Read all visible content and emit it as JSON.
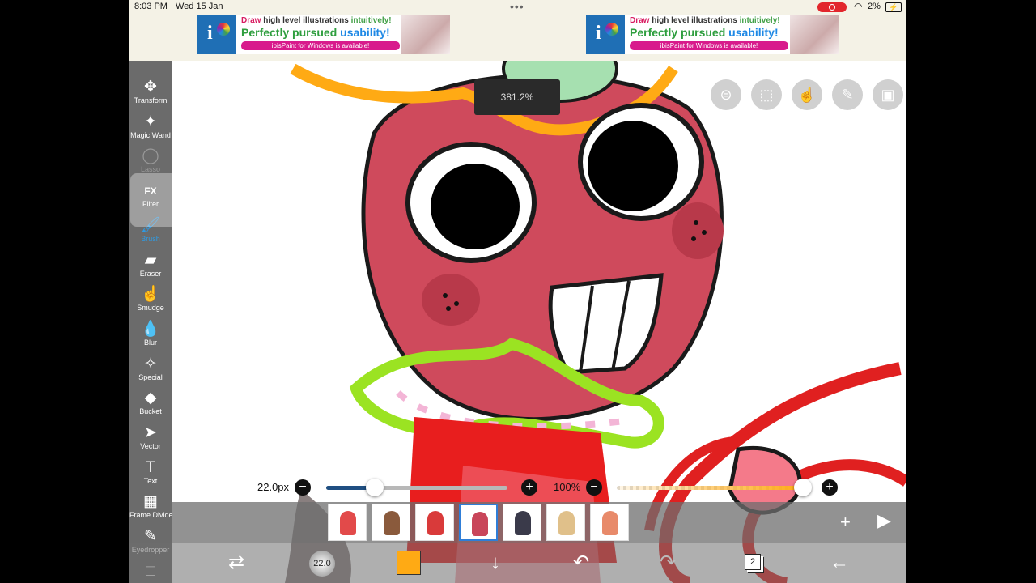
{
  "status": {
    "time": "8:03 PM",
    "date": "Wed 15 Jan",
    "dots": "•••",
    "battery_pct": "2%",
    "battery_glyph": "⚡"
  },
  "ad": {
    "draw": "Draw",
    "line1_rest_a": " high level illustrations ",
    "line1_green": "intuitively!",
    "line2_a": "Perfectly pursued ",
    "line2_b": "usability!",
    "line3": "ibisPaint for Windows is available!",
    "logo_letter": "i"
  },
  "zoom_label": "381.2%",
  "tools": [
    {
      "name": "transform",
      "label": "Transform",
      "icon": "✥"
    },
    {
      "name": "magic-wand",
      "label": "Magic Wand",
      "icon": "✦"
    },
    {
      "name": "lasso",
      "label": "Lasso",
      "icon": "◯"
    },
    {
      "name": "filter",
      "label": "Filter",
      "icon": "FX"
    },
    {
      "name": "brush",
      "label": "Brush",
      "icon": "🖌"
    },
    {
      "name": "eraser",
      "label": "Eraser",
      "icon": "▰"
    },
    {
      "name": "smudge",
      "label": "Smudge",
      "icon": "☝"
    },
    {
      "name": "blur",
      "label": "Blur",
      "icon": "💧"
    },
    {
      "name": "special",
      "label": "Special",
      "icon": "✧"
    },
    {
      "name": "bucket",
      "label": "Bucket",
      "icon": "◆"
    },
    {
      "name": "vector",
      "label": "Vector",
      "icon": "➤"
    },
    {
      "name": "text",
      "label": "Text",
      "icon": "T"
    },
    {
      "name": "frame-divider",
      "label": "Frame Divider",
      "icon": "▦"
    },
    {
      "name": "eyedropper",
      "label": "Eyedropper",
      "icon": "✎"
    },
    {
      "name": "canvas",
      "label": "",
      "icon": "□"
    }
  ],
  "top_buttons": [
    {
      "name": "toggle-icon",
      "glyph": "⊜"
    },
    {
      "name": "selection-icon",
      "glyph": "⬚"
    },
    {
      "name": "hand-icon",
      "glyph": "☝"
    },
    {
      "name": "pencil-icon",
      "glyph": "✎"
    },
    {
      "name": "image-icon",
      "glyph": "▣"
    }
  ],
  "brush_size": {
    "label": "22.0px",
    "value_fraction": 0.27,
    "minus": "−",
    "plus": "+"
  },
  "opacity": {
    "label": "100%",
    "value_fraction": 1.0,
    "minus": "−",
    "plus": "+"
  },
  "frames": [
    {
      "color": "#e24a4a"
    },
    {
      "color": "#8a5a3c"
    },
    {
      "color": "#d93a3a"
    },
    {
      "color": "#c9455a"
    },
    {
      "color": "#3a3a4a"
    },
    {
      "color": "#e0c08a"
    },
    {
      "color": "#e88a6a"
    }
  ],
  "framebar": {
    "add": "+",
    "play": "▶",
    "more": "⋮"
  },
  "bottom": {
    "brush_size_short": "22.0",
    "transform_glyph": "⇄",
    "down_glyph": "↓",
    "undo_glyph": "↶",
    "redo_glyph": "↷",
    "layers_count": "2",
    "back_glyph": "←"
  },
  "colors": {
    "current": "#ffaa14",
    "accent": "#2f9be4"
  }
}
